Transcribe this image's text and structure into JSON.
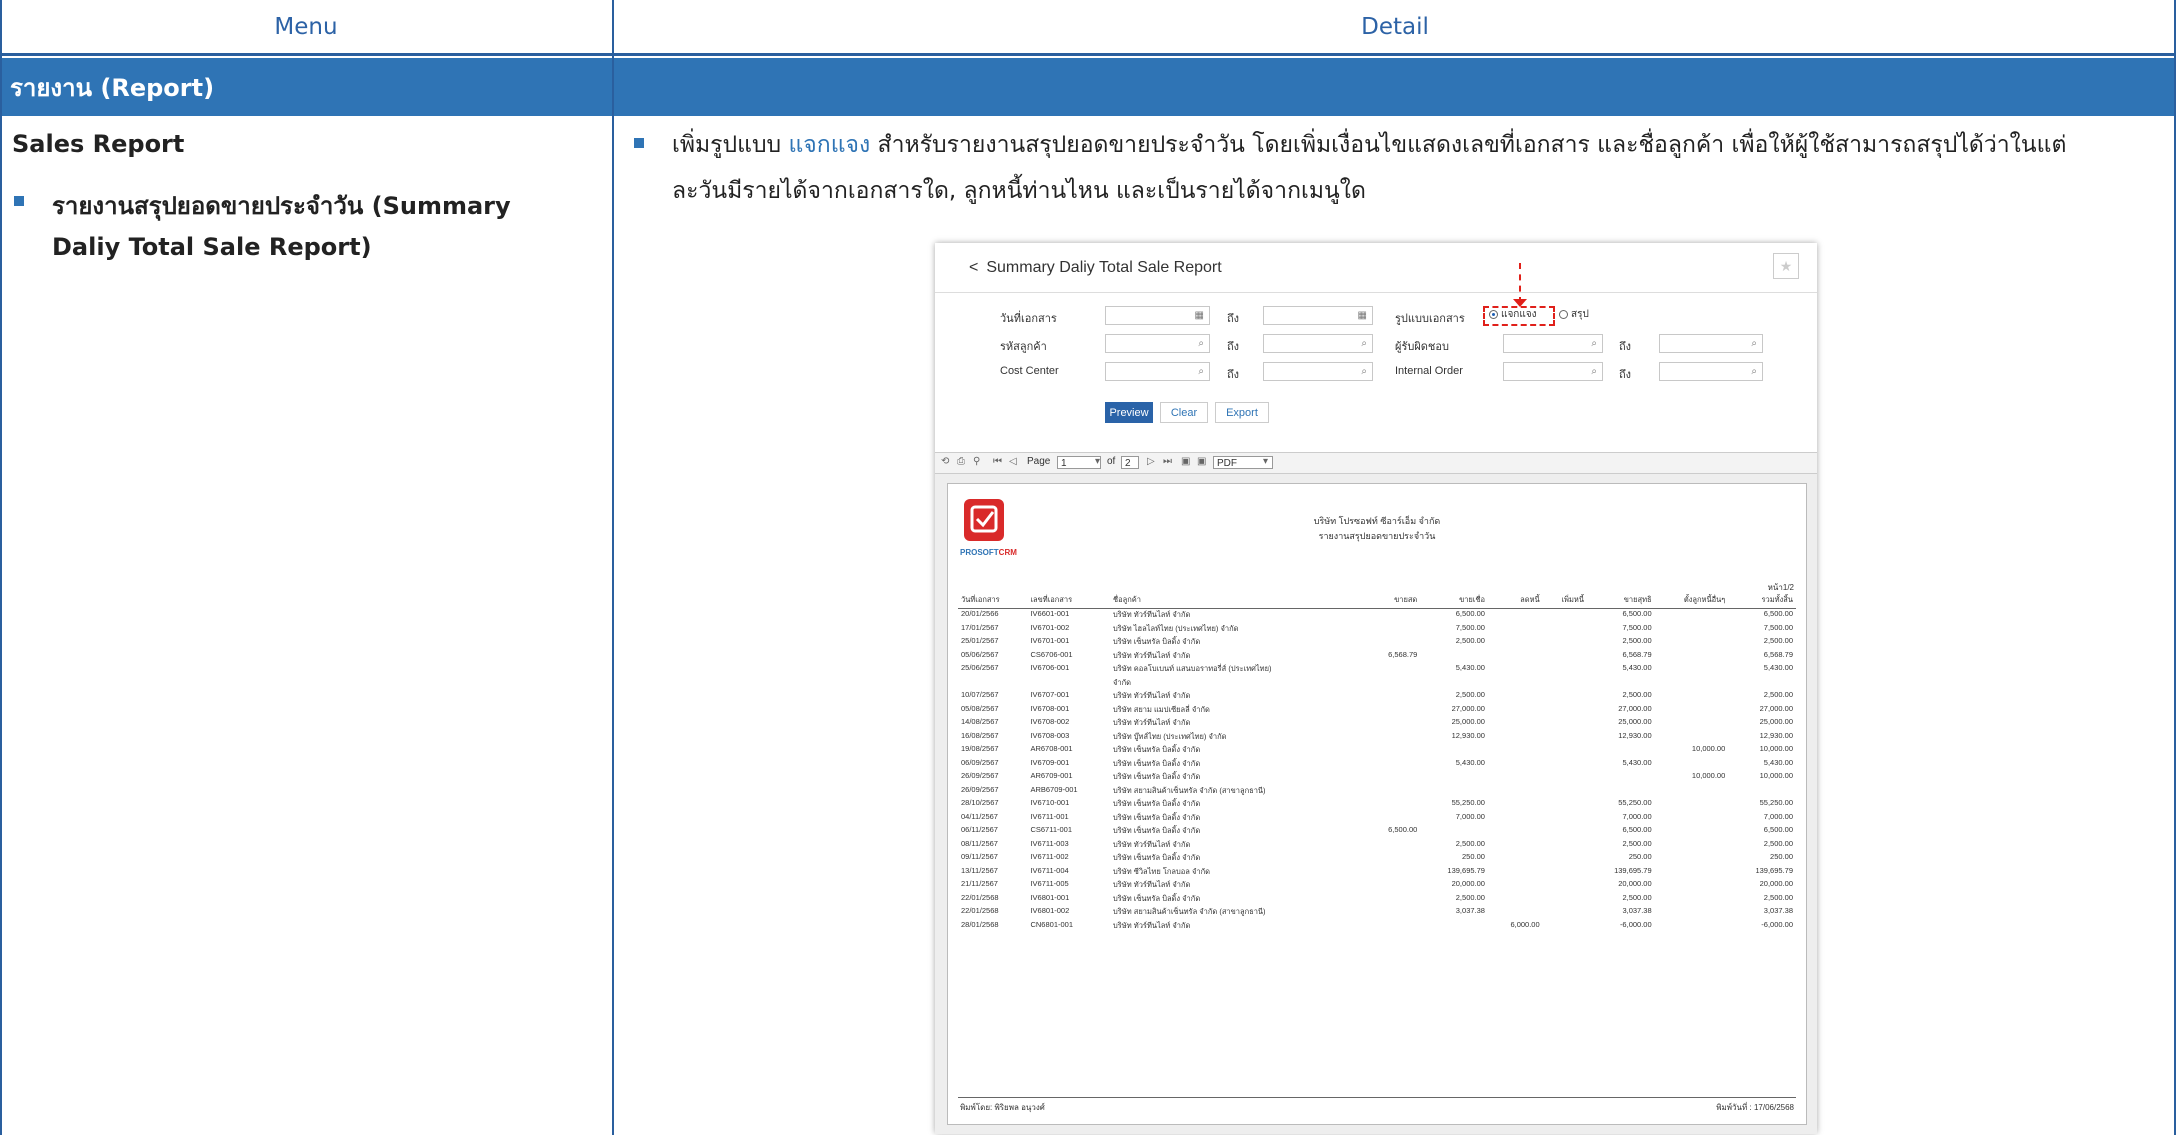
{
  "header": {
    "menu_label": "Menu",
    "detail_label": "Detail"
  },
  "section": {
    "title": "รายงาน (Report)"
  },
  "menu": {
    "heading": "Sales Report",
    "item_line1": "รายงานสรุปยอดขายประจำวัน (Summary",
    "item_line2": "Daliy Total Sale Report)"
  },
  "detail": {
    "line1_pre": "เพิ่มรูปแบบ ",
    "line1_link": "แจกแจง",
    "line1_post": " สำหรับรายงานสรุปยอดขายประจำวัน โดยเพิ่มเงื่อนไขแสดงเลขที่เอกสาร และชื่อลูกค้า เพื่อให้ผู้ใช้สามารถสรุปได้ว่าในแต่",
    "line2": "ละวันมีรายได้จากเอกสารใด, ลูกหนี้ท่านไหน และเป็นรายได้จากเมนูใด"
  },
  "report_window": {
    "back": "<",
    "title": "Summary Daliy Total Sale Report",
    "star": "★",
    "filters": {
      "doc_date": "วันที่เอกสาร",
      "to": "ถึง",
      "customer_code": "รหัสลูกค้า",
      "cost_center": "Cost Center",
      "doc_format": "รูปแบบเอกสาร",
      "responsible": "ผู้รับผิดชอบ",
      "internal_order": "Internal Order",
      "radio_detail": "แจกแจง",
      "radio_summary": "สรุป",
      "calendar_icon": "▦",
      "search_icon": "⌕"
    },
    "buttons": {
      "preview": "Preview",
      "clear": "Clear",
      "export": "Export"
    },
    "viewer": {
      "page_label": "Page",
      "page_value": "1",
      "of_label": "of",
      "total_pages": "2",
      "format": "PDF"
    }
  },
  "report": {
    "logo_text_a": "PROSOFT",
    "logo_text_b": "CRM",
    "company": "บริษัท โปรซอฟท์ ซีอาร์เอ็ม จำกัด",
    "subtitle": "รายงานสรุปยอดขายประจำวัน",
    "page_no": "หน้า1/2",
    "columns": [
      "วันที่เอกสาร",
      "เลขที่เอกสาร",
      "ชื่อลูกค้า",
      "ขายสด",
      "ขายเชื่อ",
      "ลดหนี้",
      "เพิ่มหนี้",
      "ขายสุทธิ",
      "ตั้งลูกหนี้อื่นๆ",
      "รวมทั้งสิ้น"
    ],
    "rows": [
      [
        "20/01/2566",
        "IV6601-001",
        "บริษัท ทัวร์ทีนไลท์ จำกัด",
        "",
        "6,500.00",
        "",
        "",
        "6,500.00",
        "",
        "6,500.00"
      ],
      [
        "17/01/2567",
        "IV6701-002",
        "บริษัท ไฮลไลท์ไทย (ประเทศไทย) จำกัด",
        "",
        "7,500.00",
        "",
        "",
        "7,500.00",
        "",
        "7,500.00"
      ],
      [
        "25/01/2567",
        "IV6701-001",
        "บริษัท เซ็นทรัล บิลดิ้ง จำกัด",
        "",
        "2,500.00",
        "",
        "",
        "2,500.00",
        "",
        "2,500.00"
      ],
      [
        "05/06/2567",
        "CS6706-001",
        "บริษัท ทัวร์ทีนไลท์ จำกัด",
        "6,568.79",
        "",
        "",
        "",
        "6,568.79",
        "",
        "6,568.79"
      ],
      [
        "25/06/2567",
        "IV6706-001",
        "บริษัท คอลโบเบนท์ แสนบอราทอรี่ส์ (ประเทศไทย)",
        "",
        "5,430.00",
        "",
        "",
        "5,430.00",
        "",
        "5,430.00"
      ],
      [
        "",
        "",
        "จำกัด",
        "",
        "",
        "",
        "",
        "",
        "",
        ""
      ],
      [
        "10/07/2567",
        "IV6707-001",
        "บริษัท ทัวร์ทีนไลท์ จำกัด",
        "",
        "2,500.00",
        "",
        "",
        "2,500.00",
        "",
        "2,500.00"
      ],
      [
        "05/08/2567",
        "IV6708-001",
        "บริษัท สยาม แมปเซียลลี่ จำกัด",
        "",
        "27,000.00",
        "",
        "",
        "27,000.00",
        "",
        "27,000.00"
      ],
      [
        "14/08/2567",
        "IV6708-002",
        "บริษัท ทัวร์ทีนไลท์ จำกัด",
        "",
        "25,000.00",
        "",
        "",
        "25,000.00",
        "",
        "25,000.00"
      ],
      [
        "16/08/2567",
        "IV6708-003",
        "บริษัท บู๊ทส์ไทย (ประเทศไทย) จำกัด",
        "",
        "12,930.00",
        "",
        "",
        "12,930.00",
        "",
        "12,930.00"
      ],
      [
        "19/08/2567",
        "AR6708-001",
        "บริษัท เซ็นทรัล บิลดิ้ง จำกัด",
        "",
        "",
        "",
        "",
        "",
        "10,000.00",
        "10,000.00"
      ],
      [
        "06/09/2567",
        "IV6709-001",
        "บริษัท เซ็นทรัล บิลดิ้ง จำกัด",
        "",
        "5,430.00",
        "",
        "",
        "5,430.00",
        "",
        "5,430.00"
      ],
      [
        "26/09/2567",
        "AR6709-001",
        "บริษัท เซ็นทรัล บิลดิ้ง จำกัด",
        "",
        "",
        "",
        "",
        "",
        "10,000.00",
        "10,000.00"
      ],
      [
        "26/09/2567",
        "ARB6709-001",
        "บริษัท สยามสินค้าเซ็นทรัล จำกัด (สาขาลูกธานี)",
        "",
        "",
        "",
        "",
        "",
        "",
        ""
      ],
      [
        "28/10/2567",
        "IV6710-001",
        "บริษัท เซ็นทรัล บิลดิ้ง จำกัด",
        "",
        "55,250.00",
        "",
        "",
        "55,250.00",
        "",
        "55,250.00"
      ],
      [
        "04/11/2567",
        "IV6711-001",
        "บริษัท เซ็นทรัล บิลดิ้ง จำกัด",
        "",
        "7,000.00",
        "",
        "",
        "7,000.00",
        "",
        "7,000.00"
      ],
      [
        "06/11/2567",
        "CS6711-001",
        "บริษัท เซ็นทรัล บิลดิ้ง จำกัด",
        "6,500.00",
        "",
        "",
        "",
        "6,500.00",
        "",
        "6,500.00"
      ],
      [
        "08/11/2567",
        "IV6711-003",
        "บริษัท ทัวร์ทีนไลท์ จำกัด",
        "",
        "2,500.00",
        "",
        "",
        "2,500.00",
        "",
        "2,500.00"
      ],
      [
        "09/11/2567",
        "IV6711-002",
        "บริษัท เซ็นทรัล บิลดิ้ง จำกัด",
        "",
        "250.00",
        "",
        "",
        "250.00",
        "",
        "250.00"
      ],
      [
        "13/11/2567",
        "IV6711-004",
        "บริษัท ซีวิลไทย โกลบอล จำกัด",
        "",
        "139,695.79",
        "",
        "",
        "139,695.79",
        "",
        "139,695.79"
      ],
      [
        "21/11/2567",
        "IV6711-005",
        "บริษัท ทัวร์ทีนไลท์ จำกัด",
        "",
        "20,000.00",
        "",
        "",
        "20,000.00",
        "",
        "20,000.00"
      ],
      [
        "22/01/2568",
        "IV6801-001",
        "บริษัท เซ็นทรัล บิลดิ้ง จำกัด",
        "",
        "2,500.00",
        "",
        "",
        "2,500.00",
        "",
        "2,500.00"
      ],
      [
        "22/01/2568",
        "IV6801-002",
        "บริษัท สยามสินค้าเซ็นทรัล จำกัด (สาขาลูกธานี)",
        "",
        "3,037.38",
        "",
        "",
        "3,037.38",
        "",
        "3,037.38"
      ],
      [
        "28/01/2568",
        "CN6801-001",
        "บริษัท ทัวร์ทีนไลท์ จำกัด",
        "",
        "",
        "6,000.00",
        "",
        "-6,000.00",
        "",
        "-6,000.00"
      ]
    ],
    "footer_left": "พิมพ์โดย:  พิริยพล อนุวงศ์",
    "footer_right": "พิมพ์วันที่ :  17/06/2568"
  },
  "colors": {
    "accent": "#2f74b5",
    "border": "#2a5f9e",
    "highlight": "#e0201a"
  }
}
